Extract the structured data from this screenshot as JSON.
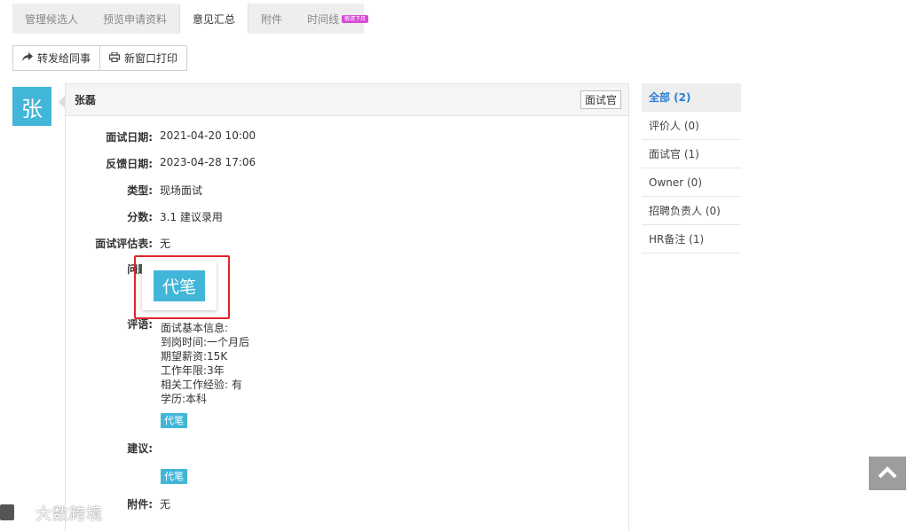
{
  "tabs": [
    {
      "label": "管理候选人",
      "active": false
    },
    {
      "label": "预览申请资料",
      "active": false
    },
    {
      "label": "意见汇总",
      "active": true
    },
    {
      "label": "附件",
      "active": false
    },
    {
      "label": "时间线",
      "active": false,
      "badge": "敬请下月"
    }
  ],
  "toolbar": {
    "forward_label": "转发给同事",
    "print_label": "新窗口打印"
  },
  "avatar": {
    "char": "张",
    "color": "#41b6d9"
  },
  "card": {
    "name": "张磊",
    "role": "面试官",
    "fields": {
      "interview_date_label": "面试日期:",
      "interview_date": "2021-04-20 10:00",
      "feedback_date_label": "反馈日期:",
      "feedback_date": "2023-04-28 17:06",
      "type_label": "类型:",
      "type": "现场面试",
      "score_label": "分数:",
      "score": "3.1 建议录用",
      "eval_form_label": "面试评估表:",
      "eval_form": "无",
      "question_label": "问题:",
      "comment_label": "评语:",
      "comment_lines": [
        "面试基本信息:",
        "到岗时间:一个月后",
        "期望薪资:15K",
        "工作年限:3年",
        "相关工作经验: 有",
        "学历:本科"
      ],
      "suggestion_label": "建议:",
      "attachment_label": "附件:",
      "attachment": "无"
    },
    "tag_label": "代笔"
  },
  "filters": [
    {
      "label": "全部 (2)",
      "active": true
    },
    {
      "label": "评价人 (0)",
      "active": false
    },
    {
      "label": "面试官 (1)",
      "active": false
    },
    {
      "label": "Owner (0)",
      "active": false
    },
    {
      "label": "招聘负责人 (0)",
      "active": false
    },
    {
      "label": "HR备注 (1)",
      "active": false
    }
  ],
  "watermark": "大数跨境",
  "colors": {
    "accent": "#41b6d9",
    "highlight_border": "#e0252b",
    "filter_active": "#2d7fd3"
  }
}
